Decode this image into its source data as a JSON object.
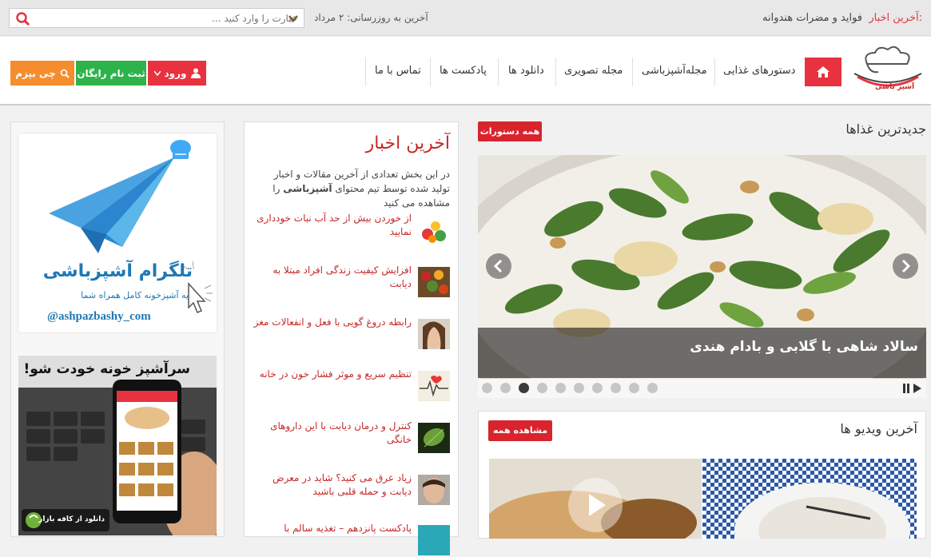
{
  "topbar": {
    "news_label": "آخرین اخبار:",
    "news_item": "فواید و مضرات هندوانه",
    "last_update": "آخرین به روزرسانی: ۲ مرداد",
    "search_placeholder": "عبارت را وارد کنید ..."
  },
  "nav": {
    "items": [
      "دستورهای غذایی",
      "مجله‌آشپزباشی",
      "مجله تصویری",
      "دانلود ها",
      "پادکست ها",
      "تماس با ما"
    ],
    "login_label": "ورود",
    "register_label": "ثبت نام رایگان",
    "what_to_cook_label": "چی بپزم"
  },
  "logo": {
    "text": "آشپز باشی"
  },
  "newest_foods": {
    "title": "جدیدترین غذاها",
    "badge": "همه دستورات",
    "slide_caption": "سالاد شاهی با گلابی و بادام هندی",
    "dot_count": 10,
    "active_dot": 3
  },
  "latest_videos": {
    "title": "آخرین ویدیو ها",
    "badge": "مشاهده همه"
  },
  "latest_news": {
    "title": "آخرین اخبار",
    "desc_1": "در این بخش تعدادی از آخرین مقالات و اخبار تولید شده توسط تیم محتوای",
    "desc_brand": "آشپزباشی",
    "desc_2": "را مشاهده می کنید",
    "items": [
      "از خوردن بیش از حد آب نبات خودداری نمایید",
      "افزایش کیفیت زندگی افراد مبتلا به دیابت",
      "رابطه دروغ گویی با فعل و انفعالات مغز",
      "تنظیم سریع و موثر فشار خون در خانه",
      "کنترل و درمان دیابت با این داروهای خانگی",
      "زیاد عرق می کنید؟ شاید در معرض دیابت و حمله قلبی باشید",
      "پادکست پانزدهم – تغذیه سالم با"
    ]
  },
  "telegram": {
    "title": "تلگرام آشپزباشی",
    "subtitle": "یه آشپزخونه کامل همراه شما",
    "handle": "@ashpazbashy_com"
  },
  "app_promo": {
    "title": "سرآشپز خونه خودت شو!",
    "download": "دانلود از کافه بازار"
  },
  "colors": {
    "accent": "#e8323f",
    "green": "#2db34a",
    "orange": "#f58d2e",
    "red_dark": "#c62828"
  }
}
